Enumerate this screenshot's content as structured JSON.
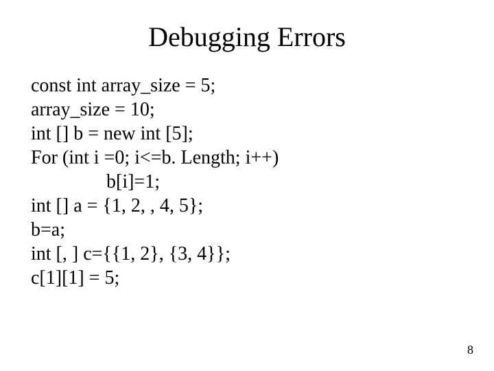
{
  "title": "Debugging Errors",
  "code": {
    "line1": "const int array_size = 5;",
    "line2": "array_size = 10;",
    "line3": "int [] b = new int [5];",
    "line4": "For (int i =0; i<=b. Length; i++)",
    "line5": "b[i]=1;",
    "line6": "int [] a = {1, 2, , 4, 5};",
    "line7": "b=a;",
    "line8": "int [, ] c={{1, 2}, {3, 4}};",
    "line9": "c[1][1] = 5;"
  },
  "pageNumber": "8"
}
